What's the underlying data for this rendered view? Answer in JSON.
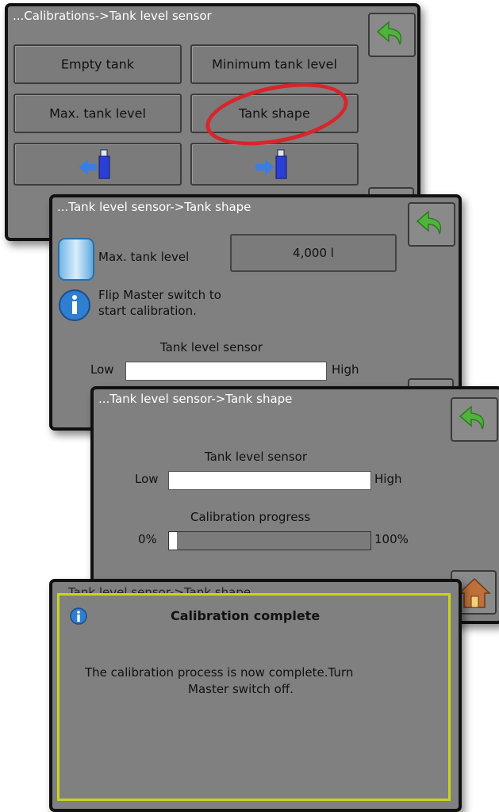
{
  "screen1": {
    "title": "...Calibrations->Tank level sensor",
    "buttons": {
      "empty_tank": "Empty tank",
      "minimum_tank_level": "Minimum tank level",
      "max_tank_level": "Max. tank level",
      "tank_shape": "Tank shape"
    },
    "icons": [
      "back-arrow-icon",
      "usb-export-icon",
      "usb-import-icon"
    ],
    "highlight_color": "#d7262b"
  },
  "screen2": {
    "title": "...Tank level sensor->Tank shape",
    "max_tank_level_label": "Max. tank level",
    "max_tank_level_value": "4,000 l",
    "info_text_line1": "Flip Master switch to",
    "info_text_line2": "start calibration.",
    "sensor_label": "Tank level sensor",
    "low_label": "Low",
    "high_label": "High"
  },
  "screen3": {
    "title": "...Tank level sensor->Tank shape",
    "sensor_label": "Tank level sensor",
    "low_label": "Low",
    "high_label": "High",
    "progress_label": "Calibration progress",
    "progress_min": "0%",
    "progress_max": "100%",
    "progress_fraction": 0.04
  },
  "screen4": {
    "title": "Tank level sensor->Tank shape",
    "dialog_title": "Calibration complete",
    "dialog_message_line1": "The calibration process is now complete.Turn",
    "dialog_message_line2": "Master switch off.",
    "border_color": "#c9d41c"
  }
}
